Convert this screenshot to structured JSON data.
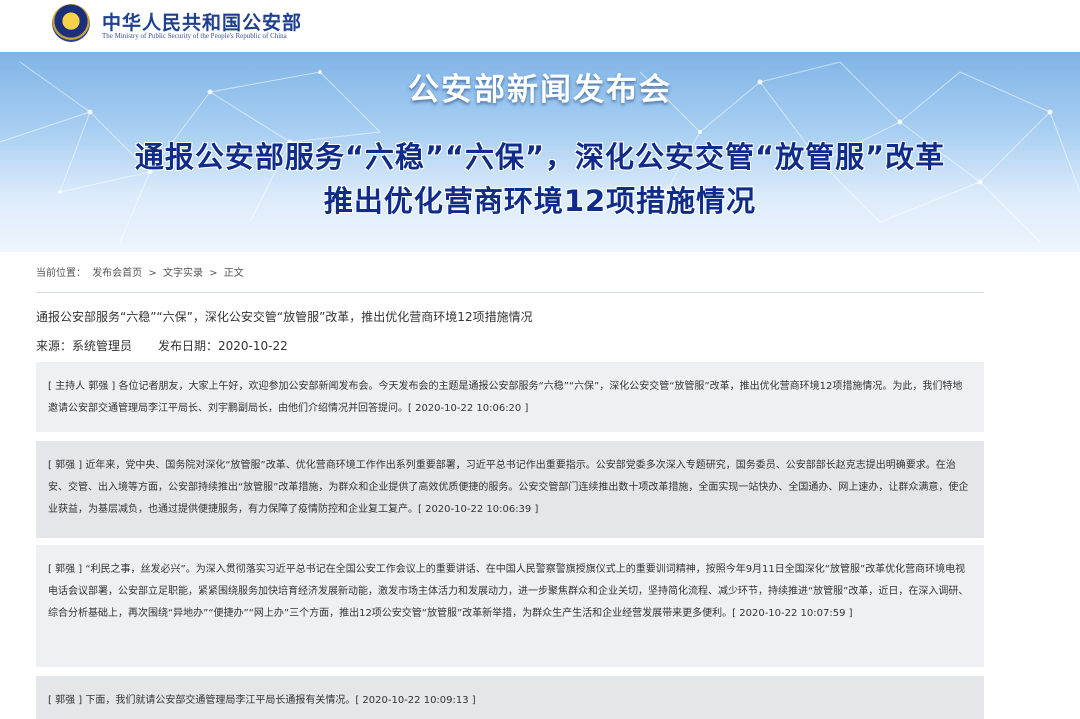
{
  "header": {
    "site_title": "中华人民共和国公安部",
    "site_subtitle": "The Ministry of Public Security of the People's Republic of China",
    "emblem_icon": "police-emblem-icon"
  },
  "banner": {
    "title": "公安部新闻发布会",
    "line1": "通报公安部服务“六稳”“六保”，深化公安交管“放管服”改革",
    "line2": "推出优化营商环境12项措施情况"
  },
  "breadcrumb": {
    "label": "当前位置：",
    "items": [
      "发布会首页",
      "文字实录",
      "正文"
    ],
    "separator": ">"
  },
  "article": {
    "title": "通报公安部服务“六稳”“六保”，深化公安交管“放管服”改革，推出优化营商环境12项措施情况",
    "source": "来源：系统管理员",
    "date": "发布日期：2020-10-22"
  },
  "entries": [
    {
      "text": "[ 主持人 郭强 ]  各位记者朋友，大家上午好，欢迎参加公安部新闻发布会。今天发布会的主题是通报公安部服务“六稳”“六保”，深化公安交管“放管服”改革，推出优化营商环境12项措施情况。为此，我们特地邀请公安部交通管理局李江平局长、刘宇鹏副局长，由他们介绍情况并回答提问。[ 2020-10-22 10:06:20 ]"
    },
    {
      "text": "[ 郭强 ]  近年来，党中央、国务院对深化“放管服”改革、优化营商环境工作作出系列重要部署，习近平总书记作出重要指示。公安部党委多次深入专题研究，国务委员、公安部部长赵克志提出明确要求。在治安、交管、出入境等方面，公安部持续推出“放管服”改革措施，为群众和企业提供了高效优质便捷的服务。公安交管部门连续推出数十项改革措施，全面实现一站快办、全国通办、网上速办，让群众满意，使企业获益，为基层减负，也通过提供便捷服务，有力保障了疫情防控和企业复工复产。[ 2020-10-22 10:06:39 ]"
    },
    {
      "text": "[ 郭强 ]  “利民之事，丝发必兴”。为深入贯彻落实习近平总书记在全国公安工作会议上的重要讲话、在中国人民警察警旗授旗仪式上的重要训词精神，按照今年9月11日全国深化“放管服”改革优化营商环境电视电话会议部署，公安部立足职能，紧紧围绕服务加快培育经济发展新动能，激发市场主体活力和发展动力，进一步聚焦群众和企业关切，坚持简化流程、减少环节，持续推进“放管服”改革，近日，在深入调研、综合分析基础上，再次围绕“异地办”“便捷办”“网上办”三个方面，推出12项公安交管“放管服”改革新举措，为群众生产生活和企业经营发展带来更多便利。[ 2020-10-22 10:07:59 ]"
    },
    {
      "text": "[ 郭强 ]  下面，我们就请公安部交通管理局李江平局长通报有关情况。[ 2020-10-22 10:09:13 ]"
    }
  ]
}
